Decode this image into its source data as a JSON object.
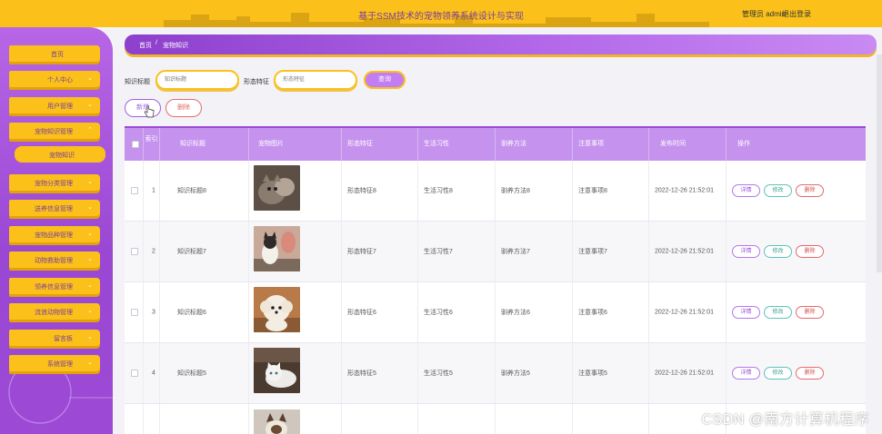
{
  "header": {
    "title": "基于SSM技术的宠物领养系统设计与实现",
    "user": "管理员 admin",
    "logout": "退出登录"
  },
  "sidebar": {
    "items": [
      {
        "label": "首页",
        "chev": ""
      },
      {
        "label": "个人中心",
        "chev": "⌄"
      },
      {
        "label": "用户管理",
        "chev": "⌄"
      },
      {
        "label": "宠物知识管理",
        "chev": "⌃"
      },
      {
        "label": "宠物知识",
        "chev": ""
      },
      {
        "label": "宠物分类管理",
        "chev": "⌄"
      },
      {
        "label": "送养信息管理",
        "chev": "⌄"
      },
      {
        "label": "宠物品种管理",
        "chev": "⌄"
      },
      {
        "label": "动物救助管理",
        "chev": "⌄"
      },
      {
        "label": "领养信息管理",
        "chev": "⌄"
      },
      {
        "label": "流浪动物管理",
        "chev": "⌄"
      },
      {
        "label": "留言板",
        "chev": "⌄"
      },
      {
        "label": "系统管理",
        "chev": "⌄"
      }
    ]
  },
  "breadcrumb": {
    "home": "首页",
    "sep": "/",
    "current": "宠物知识"
  },
  "search": {
    "label1": "知识标题",
    "placeholder1": "知识标题",
    "label2": "形态特征",
    "placeholder2": "形态特征",
    "query": "查询"
  },
  "actions": {
    "add": "新增",
    "delete": "删除"
  },
  "table": {
    "headers": [
      "索引",
      "知识标题",
      "宠物图片",
      "形态特征",
      "生活习性",
      "驯养方法",
      "注意事项",
      "发布时间",
      "操作"
    ],
    "op_labels": {
      "detail": "详情",
      "edit": "修改",
      "remove": "删除"
    },
    "rows": [
      {
        "index": "1",
        "title": "知识标题8",
        "form": "形态特征8",
        "habit": "生活习性8",
        "method": "驯养方法8",
        "note": "注意事项8",
        "time": "2022-12-26 21:52:01"
      },
      {
        "index": "2",
        "title": "知识标题7",
        "form": "形态特征7",
        "habit": "生活习性7",
        "method": "驯养方法7",
        "note": "注意事项7",
        "time": "2022-12-26 21:52:01"
      },
      {
        "index": "3",
        "title": "知识标题6",
        "form": "形态特征6",
        "habit": "生活习性6",
        "method": "驯养方法6",
        "note": "注意事项6",
        "time": "2022-12-26 21:52:01"
      },
      {
        "index": "4",
        "title": "知识标题5",
        "form": "形态特征5",
        "habit": "生活习性5",
        "method": "驯养方法5",
        "note": "注意事项5",
        "time": "2022-12-26 21:52:01"
      }
    ]
  },
  "watermark": "CSDN @南方计算机程序"
}
